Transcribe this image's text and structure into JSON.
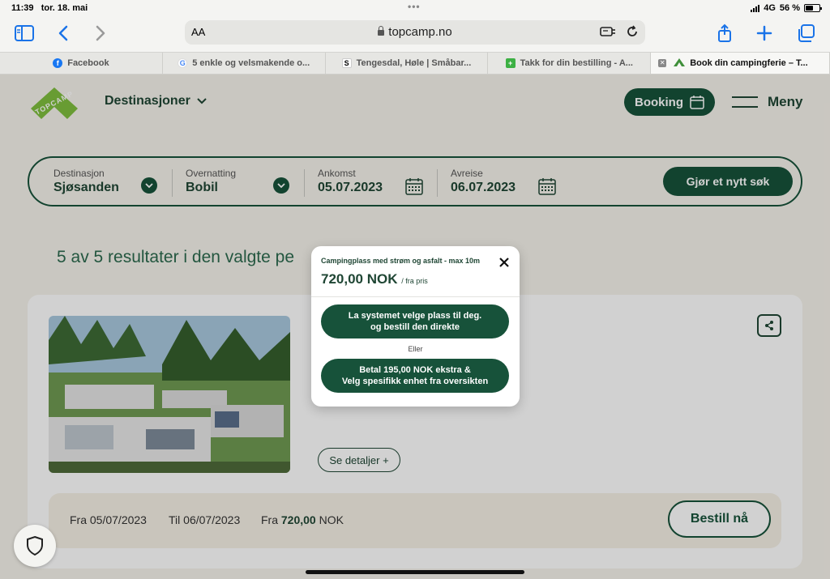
{
  "status": {
    "time": "11:39",
    "date": "tor. 18. mai",
    "network": "4G",
    "battery": "56 %",
    "battery_level": 0.56
  },
  "toolbar": {
    "text_size": "AA",
    "url": "topcamp.no"
  },
  "tabs": [
    {
      "label": "Facebook",
      "icon": "facebook-icon"
    },
    {
      "label": "5 enkle og velsmakende o...",
      "icon": "google-icon"
    },
    {
      "label": "Tengesdal, Høle | Småbar...",
      "icon": "s-icon"
    },
    {
      "label": "Takk for din bestilling - A...",
      "icon": "plus-icon"
    },
    {
      "label": "Book din campingferie – T...",
      "icon": "topcamp-icon",
      "active": true
    }
  ],
  "header": {
    "logo_text": "TOPCAMP",
    "destinations": "Destinasjoner",
    "booking": "Booking",
    "menu": "Meny"
  },
  "search": {
    "destination_label": "Destinasjon",
    "destination_value": "Sjøsanden",
    "accommodation_label": "Overnatting",
    "accommodation_value": "Bobil",
    "arrival_label": "Ankomst",
    "arrival_value": "05.07.2023",
    "departure_label": "Avreise",
    "departure_value": "06.07.2023",
    "button": "Gjør et nytt søk"
  },
  "results": {
    "text": "5 av 5 resultater i den valgte pe"
  },
  "card": {
    "title": "øm og asfalt - max 10m",
    "details": "Se detaljer +",
    "from_date_label": "Fra",
    "from_date": "05/07/2023",
    "to_date_label": "Til",
    "to_date": "06/07/2023",
    "price_label": "Fra",
    "price": "720,00",
    "currency": "NOK",
    "order_button": "Bestill nå"
  },
  "modal": {
    "title": "Campingplass med strøm og asfalt - max 10m",
    "price": "720,00 NOK",
    "price_suffix": "/ fra pris",
    "option1_line1": "La systemet velge plass til deg.",
    "option1_line2": "og bestill den direkte",
    "or": "Eller",
    "option2_line1": "Betal 195,00 NOK ekstra &",
    "option2_line2": "Velg spesifikk enhet fra oversikten"
  },
  "colors": {
    "brand_green": "#17523a",
    "light_green": "#7fbf3f",
    "page_bg": "#f6f3ec"
  }
}
